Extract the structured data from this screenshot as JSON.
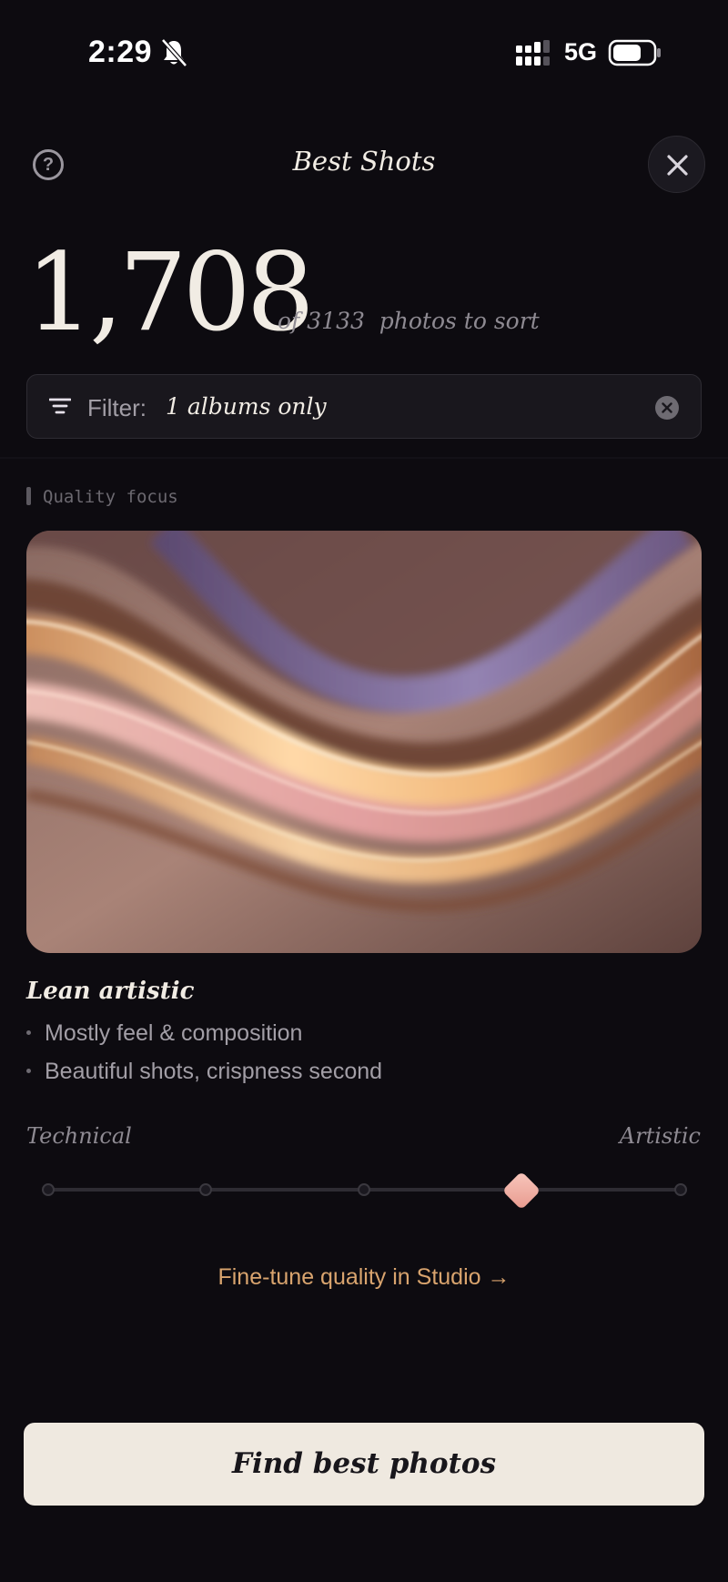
{
  "status_bar": {
    "time": "2:29",
    "network": "5G",
    "icons": [
      "bell-slash-icon",
      "signal-icon",
      "battery-icon"
    ]
  },
  "header": {
    "title": "Best Shots",
    "help_icon": "question-circle-icon",
    "close_icon": "close-icon"
  },
  "summary": {
    "count": "1,708",
    "subtitle": "of 3133  photos to sort"
  },
  "filter": {
    "label": "Filter:",
    "value": "1 albums only",
    "icon": "filter-lines-icon",
    "clear_icon": "clear-circle-icon"
  },
  "quality": {
    "section_label": "Quality focus",
    "mode_title": "Lean artistic",
    "bullets": [
      "Mostly feel & composition",
      "Beautiful shots, crispness second"
    ],
    "slider": {
      "left_label": "Technical",
      "right_label": "Artistic",
      "steps": 5,
      "selected_step": 4
    },
    "studio_link": "Fine-tune quality in Studio →"
  },
  "cta": {
    "label": "Find best photos"
  },
  "colors": {
    "background": "#0d0b10",
    "accent": "#d9a46e",
    "thumb": "#f3b2a6",
    "cta_background": "#efe9e0"
  }
}
